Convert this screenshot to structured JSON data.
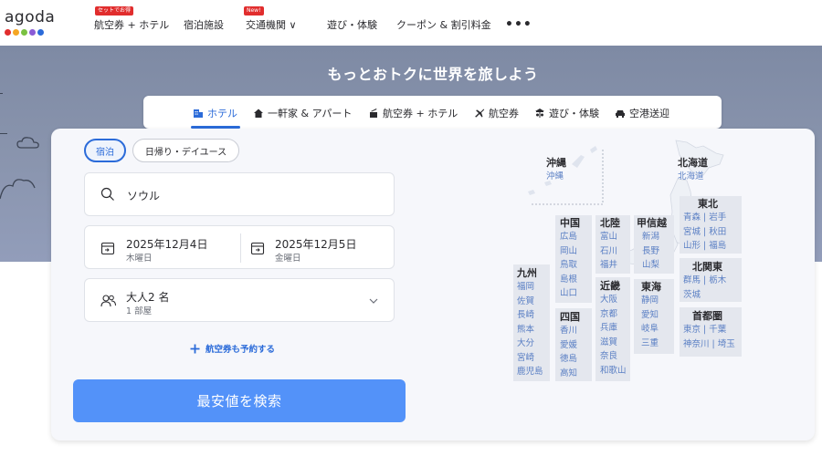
{
  "brand": {
    "logo_text": "agoda",
    "dot_colors": [
      "#e12d2d",
      "#f5a623",
      "#7ac142",
      "#8a5bd6",
      "#2b6bd9"
    ]
  },
  "nav": {
    "items": [
      {
        "label": "航空券 + ホテル",
        "badge": "セットでお得"
      },
      {
        "label": "宿泊施設"
      },
      {
        "label": "交通機関 ∨",
        "badge": "New!"
      },
      {
        "label": "遊び・体験"
      },
      {
        "label": "クーポン & 割引料金"
      }
    ],
    "more": "•••"
  },
  "hero": {
    "title": "もっとおトクに世界を旅しよう"
  },
  "tabs": [
    {
      "label": "ホテル",
      "icon": "hotel-icon",
      "active": true
    },
    {
      "label": "一軒家 & アパート",
      "icon": "house-icon"
    },
    {
      "label": "航空券 + ホテル",
      "icon": "flight-hotel-icon"
    },
    {
      "label": "航空券",
      "icon": "airplane-icon"
    },
    {
      "label": "遊び・体験",
      "icon": "activity-icon"
    },
    {
      "label": "空港送迎",
      "icon": "car-icon"
    }
  ],
  "search": {
    "stay_types": [
      {
        "label": "宿泊",
        "active": true
      },
      {
        "label": "日帰り・デイユース",
        "active": false
      }
    ],
    "destination": "ソウル",
    "checkin": {
      "date": "2025年12月4日",
      "weekday": "木曜日"
    },
    "checkout": {
      "date": "2025年12月5日",
      "weekday": "金曜日"
    },
    "guests": {
      "occupancy": "大人2 名",
      "rooms": "1 部屋"
    },
    "add_flight": "航空券も予約する",
    "submit": "最安値を検索"
  },
  "map": {
    "regions": {
      "okinawa": {
        "title": "沖縄",
        "prefs": [
          "沖縄"
        ]
      },
      "hokkaido": {
        "title": "北海道",
        "prefs": [
          "北海道"
        ]
      },
      "tohoku": {
        "title": "東北",
        "rows": [
          "青森 | 岩手",
          "宮城 | 秋田",
          "山形 | 福島"
        ]
      },
      "chugoku": {
        "title": "中国",
        "prefs": [
          "広島",
          "岡山",
          "鳥取",
          "島根",
          "山口"
        ]
      },
      "hokuriku": {
        "title": "北陸",
        "prefs": [
          "富山",
          "石川",
          "福井"
        ]
      },
      "koshinetsu": {
        "title": "甲信越",
        "prefs": [
          "新潟",
          "長野",
          "山梨"
        ]
      },
      "kitakanto": {
        "title": "北関東",
        "rows": [
          "群馬 | 栃木",
          "茨城"
        ]
      },
      "kyushu": {
        "title": "九州",
        "prefs": [
          "福岡",
          "佐賀",
          "長崎",
          "熊本",
          "大分",
          "宮崎",
          "鹿児島"
        ]
      },
      "kinki": {
        "title": "近畿",
        "prefs": [
          "大阪",
          "京都",
          "兵庫",
          "滋賀",
          "奈良",
          "和歌山"
        ]
      },
      "tokai": {
        "title": "東海",
        "prefs": [
          "静岡",
          "愛知",
          "岐阜",
          "三重"
        ]
      },
      "shikoku": {
        "title": "四国",
        "prefs": [
          "香川",
          "愛媛",
          "徳島",
          "高知"
        ]
      },
      "shutoken": {
        "title": "首都圏",
        "rows": [
          "東京 | 千葉",
          "神奈川 | 埼玉"
        ]
      }
    }
  },
  "colors": {
    "accent": "#2b6bd9",
    "button": "#5392f9",
    "hero": "#8994ad",
    "badge": "#e12d2d"
  }
}
